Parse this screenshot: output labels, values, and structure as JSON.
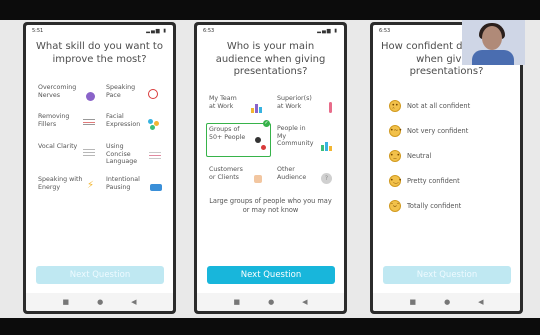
{
  "colors": {
    "accent": "#18b6db",
    "accent_disabled": "#bfe8f2",
    "selected": "#37b34a"
  },
  "screens": [
    {
      "time": "5:51",
      "title": "What skill do you want to improve the most?",
      "options": [
        {
          "label": "Overcoming Nerves",
          "icon": "purple-circle-icon"
        },
        {
          "label": "Speaking Pace",
          "icon": "speedometer-icon"
        },
        {
          "label": "Removing Fillers",
          "icon": "filler-text-icon"
        },
        {
          "label": "Facial Expression",
          "icon": "colored-dots-icon"
        },
        {
          "label": "Vocal Clarity",
          "icon": "clarity-lines-icon"
        },
        {
          "label": "Using Concise Language",
          "icon": "text-lines-icon"
        },
        {
          "label": "Speaking with Energy",
          "icon": "lightning-icon"
        },
        {
          "label": "Intentional Pausing",
          "icon": "pause-bubble-icon"
        }
      ],
      "button": "Next Question"
    },
    {
      "time": "6:53",
      "title": "Who is your main audience when giving presentations?",
      "options": [
        {
          "label": "My Team at Work",
          "icon": "bar-chart-icon"
        },
        {
          "label": "Superior(s) at Work",
          "icon": "thermometer-icon"
        },
        {
          "label": "Groups of 50+ People",
          "icon": "microphone-icon",
          "selected": true
        },
        {
          "label": "People in My Community",
          "icon": "community-icon"
        },
        {
          "label": "Customers or Clients",
          "icon": "hand-icon"
        },
        {
          "label": "Other Audience",
          "icon": "question-icon"
        }
      ],
      "description": "Large groups of people who you may or may not know",
      "button": "Next Question"
    },
    {
      "time": "6:53",
      "title": "How confident do you feel when giving presentations?",
      "options": [
        {
          "label": "Not at all confident",
          "icon": "worried-face-icon"
        },
        {
          "label": "Not very confident",
          "icon": "unsure-face-icon"
        },
        {
          "label": "Neutral",
          "icon": "neutral-face-icon"
        },
        {
          "label": "Pretty confident",
          "icon": "smile-face-icon"
        },
        {
          "label": "Totally confident",
          "icon": "grin-face-icon"
        }
      ],
      "button": "Next Question"
    }
  ]
}
